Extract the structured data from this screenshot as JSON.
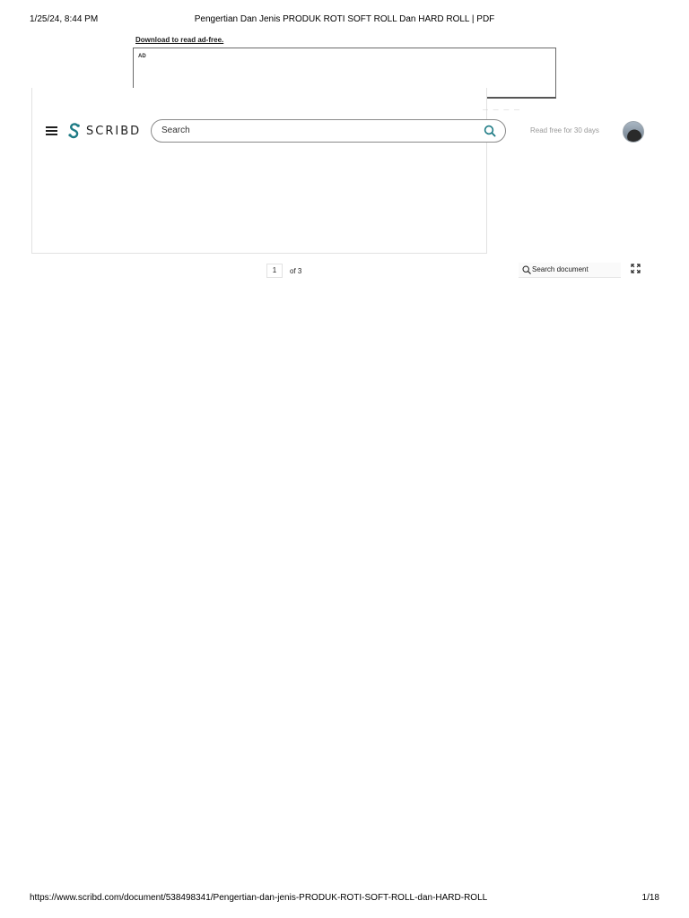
{
  "print_header": {
    "date": "1/25/24, 8:44 PM",
    "title": "Pengertian Dan Jenis PRODUK ROTI SOFT ROLL Dan HARD ROLL | PDF"
  },
  "ad": {
    "download_link": "Download to read ad-free.",
    "label": "AD"
  },
  "nav": {
    "menu_icon": "hamburger-menu-icon",
    "logo_text": "SCRIBD",
    "logo_color": "#1e7b85",
    "search_placeholder": "Search",
    "search_icon": "search-icon",
    "search_icon_color": "#1e7b85",
    "read_free": "Read free for 30 days",
    "avatar_icon": "user-avatar"
  },
  "viewer": {
    "current_page": "1",
    "of_pages": "of 3",
    "search_document": "Search document",
    "fullscreen_icon": "fullscreen-icon"
  },
  "print_footer": {
    "url": "https://www.scribd.com/document/538498341/Pengertian-dan-jenis-PRODUK-ROTI-SOFT-ROLL-dan-HARD-ROLL",
    "page_count": "1/18"
  }
}
